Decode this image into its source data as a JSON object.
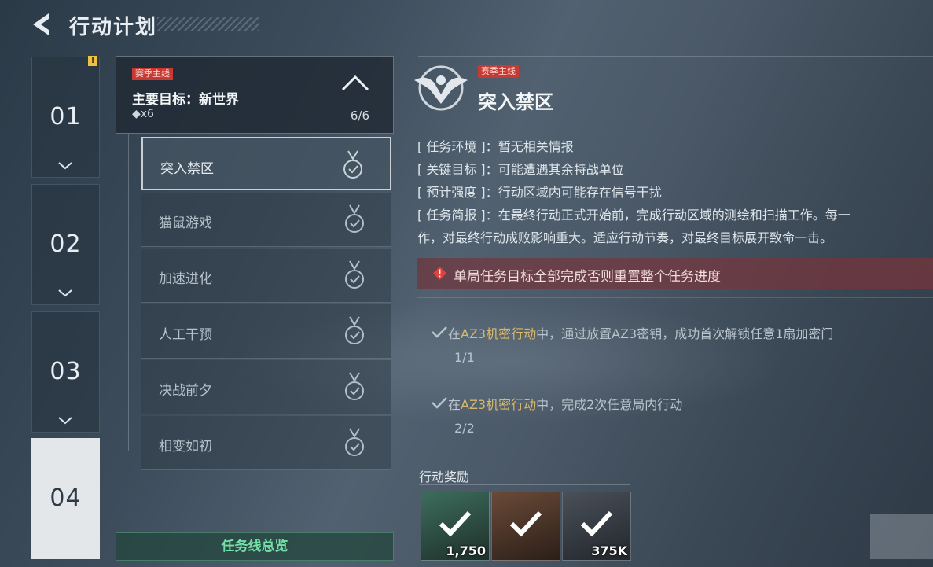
{
  "header": {
    "title": "行动计划",
    "back_icon": "back-arrow-icon"
  },
  "chapters": [
    {
      "label": "01",
      "has_alert": true,
      "alert_text": "!"
    },
    {
      "label": "02"
    },
    {
      "label": "03"
    },
    {
      "label": "04",
      "active": true
    }
  ],
  "main_mission": {
    "tag": "赛季主线",
    "goal": "主要目标：新世界",
    "reward": "◆x6",
    "progress": "6/6"
  },
  "sub_missions": [
    {
      "label": "突入禁区",
      "completed": true,
      "selected": true
    },
    {
      "label": "猫鼠游戏",
      "completed": true
    },
    {
      "label": "加速进化",
      "completed": true
    },
    {
      "label": "人工干预",
      "completed": true
    },
    {
      "label": "决战前夕",
      "completed": true
    },
    {
      "label": "相变如初",
      "completed": true
    }
  ],
  "overview_button": "任务线总览",
  "detail": {
    "tag": "赛季主线",
    "title": "突入禁区",
    "info": [
      {
        "key": "任务环境",
        "value": "暂无相关情报"
      },
      {
        "key": "关键目标",
        "value": "可能遭遇其余特战单位"
      },
      {
        "key": "预计强度",
        "value": "行动区域内可能存在信号干扰"
      },
      {
        "key": "任务简报",
        "value": "在最终行动正式开始前，完成行动区域的测绘和扫描工作。每一"
      }
    ],
    "briefing_cont": "作，对最终行动成败影响重大。适应行动节奏，对最终目标展开致命一击。",
    "warning": "单局任务目标全部完成否则重置整个任务进度",
    "tasks": [
      {
        "pre": "在",
        "hl": "AZ3机密行动",
        "post": "中，通过放置AZ3密钥，成功首次解锁任意1扇加密门",
        "count": "1/1"
      },
      {
        "pre": "在",
        "hl": "AZ3机密行动",
        "post": "中，完成2次任意局内行动",
        "count": "2/2"
      }
    ],
    "rewards_title": "行动奖励",
    "rewards": [
      {
        "amount": "1,750",
        "icon": "emblem-icon",
        "color": "#2e5a4a"
      },
      {
        "amount": "",
        "icon": "gear-pack-icon",
        "color": "#4a3a30"
      },
      {
        "amount": "375K",
        "icon": "currency-coin-icon",
        "color": "#3a4048"
      }
    ]
  },
  "colors": {
    "accent_red": "#c73a34",
    "accent_green": "#73e0a5",
    "highlight_gold": "#d8b86a"
  }
}
